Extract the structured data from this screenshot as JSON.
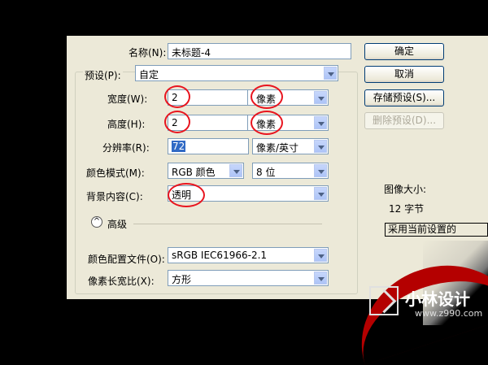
{
  "dialog": {
    "name": {
      "label": "名称(N):",
      "value": "未标题-4"
    },
    "preset": {
      "label": "预设(P):",
      "value": "自定"
    },
    "width": {
      "label": "宽度(W):",
      "value": "2",
      "unit": "像素"
    },
    "height": {
      "label": "高度(H):",
      "value": "2",
      "unit": "像素"
    },
    "resolution": {
      "label": "分辨率(R):",
      "value": "72",
      "unit": "像素/英寸"
    },
    "color_mode": {
      "label": "颜色模式(M):",
      "value": "RGB 颜色",
      "bits": "8 位"
    },
    "background": {
      "label": "背景内容(C):",
      "value": "透明"
    },
    "advanced": {
      "label": "高级"
    },
    "color_profile": {
      "label": "颜色配置文件(O):",
      "value": "sRGB IEC61966-2.1"
    },
    "pixel_aspect": {
      "label": "像素长宽比(X):",
      "value": "方形"
    }
  },
  "buttons": {
    "ok": "确定",
    "cancel": "取消",
    "save_preset": "存储预设(S)...",
    "delete_preset": "删除预设(D)..."
  },
  "info": {
    "image_size_label": "图像大小:",
    "image_size_value": "12 字节",
    "use_current": "采用当前设置的"
  },
  "watermark": {
    "title": "小林设计",
    "url": "www.z990.com"
  },
  "colors": {
    "annotation": "#e8141e",
    "accent": "#b40000"
  }
}
